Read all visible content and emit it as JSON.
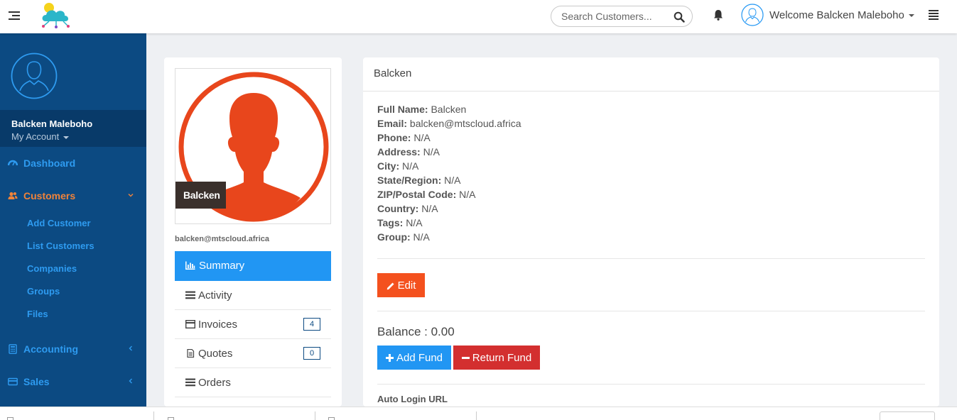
{
  "header": {
    "search_placeholder": "Search Customers...",
    "welcome": "Welcome Balcken Maleboho"
  },
  "sidebar": {
    "user_name": "Balcken Maleboho",
    "account_label": "My Account",
    "nav": {
      "dashboard": "Dashboard",
      "customers": "Customers",
      "accounting": "Accounting",
      "sales": "Sales"
    },
    "customers_sub": [
      "Add Customer",
      "List Customers",
      "Companies",
      "Groups",
      "Files"
    ]
  },
  "profile": {
    "photo_label": "Balcken",
    "email": "balcken@mtscloud.africa",
    "menu": [
      {
        "label": "Summary"
      },
      {
        "label": "Activity"
      },
      {
        "label": "Invoices",
        "badge": "4"
      },
      {
        "label": "Quotes",
        "badge": "0"
      },
      {
        "label": "Orders"
      }
    ]
  },
  "main": {
    "title": "Balcken",
    "details": [
      {
        "key": "Full Name:",
        "value": "Balcken"
      },
      {
        "key": "Email:",
        "value": "balcken@mtscloud.africa"
      },
      {
        "key": "Phone:",
        "value": "N/A"
      },
      {
        "key": "Address:",
        "value": "N/A"
      },
      {
        "key": "City:",
        "value": "N/A"
      },
      {
        "key": "State/Region:",
        "value": "N/A"
      },
      {
        "key": "ZIP/Postal Code:",
        "value": "N/A"
      },
      {
        "key": "Country:",
        "value": "N/A"
      },
      {
        "key": "Tags:",
        "value": "N/A"
      },
      {
        "key": "Group:",
        "value": "N/A"
      }
    ],
    "edit_label": "Edit",
    "balance": "Balance : 0.00",
    "add_fund_label": "Add Fund",
    "return_fund_label": "Return Fund",
    "auto_login_label": "Auto Login URL"
  },
  "colors": {
    "sidebar_bg": "#0c4a82",
    "nav_text": "#2e9bf0",
    "nav_active": "#f0833a",
    "primary": "#2196f3",
    "edit": "#f4511e",
    "danger": "#d32f2f",
    "avatar": "#e8461c"
  },
  "icons": {
    "menu": "hamburger-icon",
    "search": "search-icon",
    "bell": "bell-icon",
    "user": "user-avatar-icon",
    "list": "list-icon"
  }
}
